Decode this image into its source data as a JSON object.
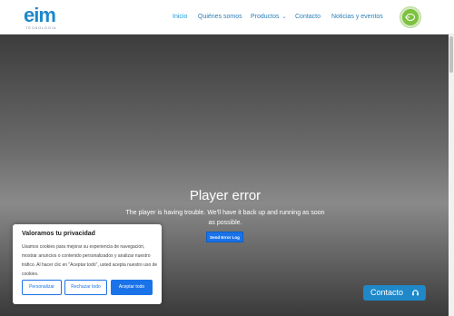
{
  "header": {
    "logo_text": "eim",
    "logo_subtext": "TECNOLOGIA",
    "nav": [
      {
        "label": "Inicio",
        "active": true
      },
      {
        "label": "Quiénes somos",
        "active": false
      },
      {
        "label": "Productos",
        "active": false
      },
      {
        "label": "Contacto",
        "active": false
      },
      {
        "label": "Noticias y eventos",
        "active": false
      }
    ],
    "badge_text": "ISO"
  },
  "player": {
    "title": "Player error",
    "message": "The player is having trouble. We'll have it back up and running as soon as possible.",
    "button_label": "Send Error Log"
  },
  "cookie": {
    "title": "Valoramos tu privacidad",
    "text": "Usamos cookies para mejorar su experiencia de navegación, mostrar anuncios o contenido personalizados y analizar nuestro tráfico. Al hacer clic en \"Aceptar todo\", usted acepta nuestro uso de cookies.",
    "buttons": {
      "customize": "Personalizar",
      "reject": "Rechazar todo",
      "accept": "Aceptar todo"
    }
  },
  "contact_button": {
    "label": "Contacto"
  },
  "colors": {
    "brand": "#1e88c9",
    "accent": "#1a73e8",
    "badge": "#7cc23f"
  }
}
